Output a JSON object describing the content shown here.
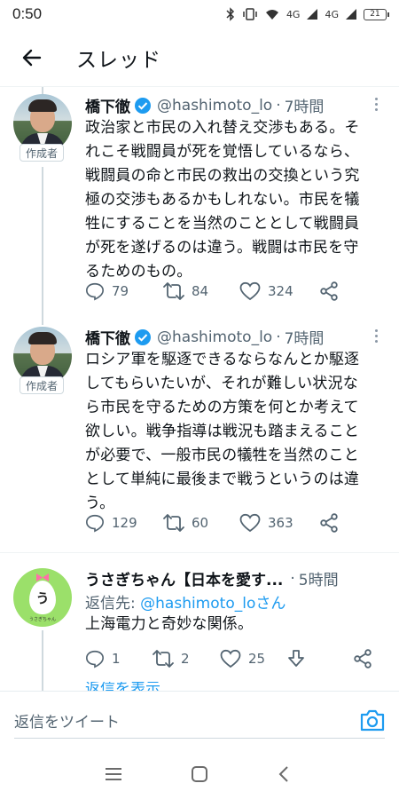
{
  "status_bar": {
    "time": "0:50",
    "network_1": "4G",
    "network_2": "4G",
    "battery": "21"
  },
  "header": {
    "title": "スレッド"
  },
  "badge_label": "作成者",
  "tweets": [
    {
      "name": "橋下徹",
      "handle": "@hashimoto_lo",
      "separator": "·",
      "time": "7時間",
      "lines": [
        "政治家と市民の入れ替え交渉もある。そ",
        "れこそ戦闘員が死を覚悟しているなら、",
        "戦闘員の命と市民の救出の交換という究",
        "極の交渉もあるかもしれない。市民を犠",
        "牲にすることを当然のこととして戦闘員",
        "が死を遂げるのは違う。戦闘は市民を守",
        "るためのもの。"
      ],
      "replies": "79",
      "retweets": "84",
      "likes": "324"
    },
    {
      "name": "橋下徹",
      "handle": "@hashimoto_lo",
      "separator": "·",
      "time": "7時間",
      "lines": [
        "ロシア軍を駆逐できるならなんとか駆逐",
        "してもらいたいが、それが難しい状況な",
        "ら市民を守るための方策を何とか考えて",
        "欲しい。戦争指導は戦況も踏まえること",
        "が必要で、一般市民の犠牲を当然のこと",
        "として単純に最後まで戦うというのは違",
        "う。"
      ],
      "replies": "129",
      "retweets": "60",
      "likes": "363"
    },
    {
      "name": "うさぎちゃん【日本を愛す...",
      "separator": "·",
      "time": "5時間",
      "reply_prefix": "返信先: ",
      "reply_handle": "@hashimoto_loさん",
      "text": "上海電力と奇妙な関係。",
      "avatar_letter": "う",
      "avatar_caption": "うさぎちゃん",
      "replies": "1",
      "retweets": "2",
      "likes": "25"
    }
  ],
  "show_replies": "返信を表示",
  "reply_bar": {
    "placeholder": "返信をツイート"
  },
  "colors": {
    "accent": "#1d9bf0",
    "muted": "#536471",
    "text": "#0f1419"
  },
  "icons": [
    "back-arrow-icon",
    "verified-icon",
    "more-icon",
    "reply-icon",
    "retweet-icon",
    "like-icon",
    "share-icon",
    "download-icon",
    "camera-icon",
    "recents-icon",
    "home-icon",
    "nav-back-icon"
  ]
}
